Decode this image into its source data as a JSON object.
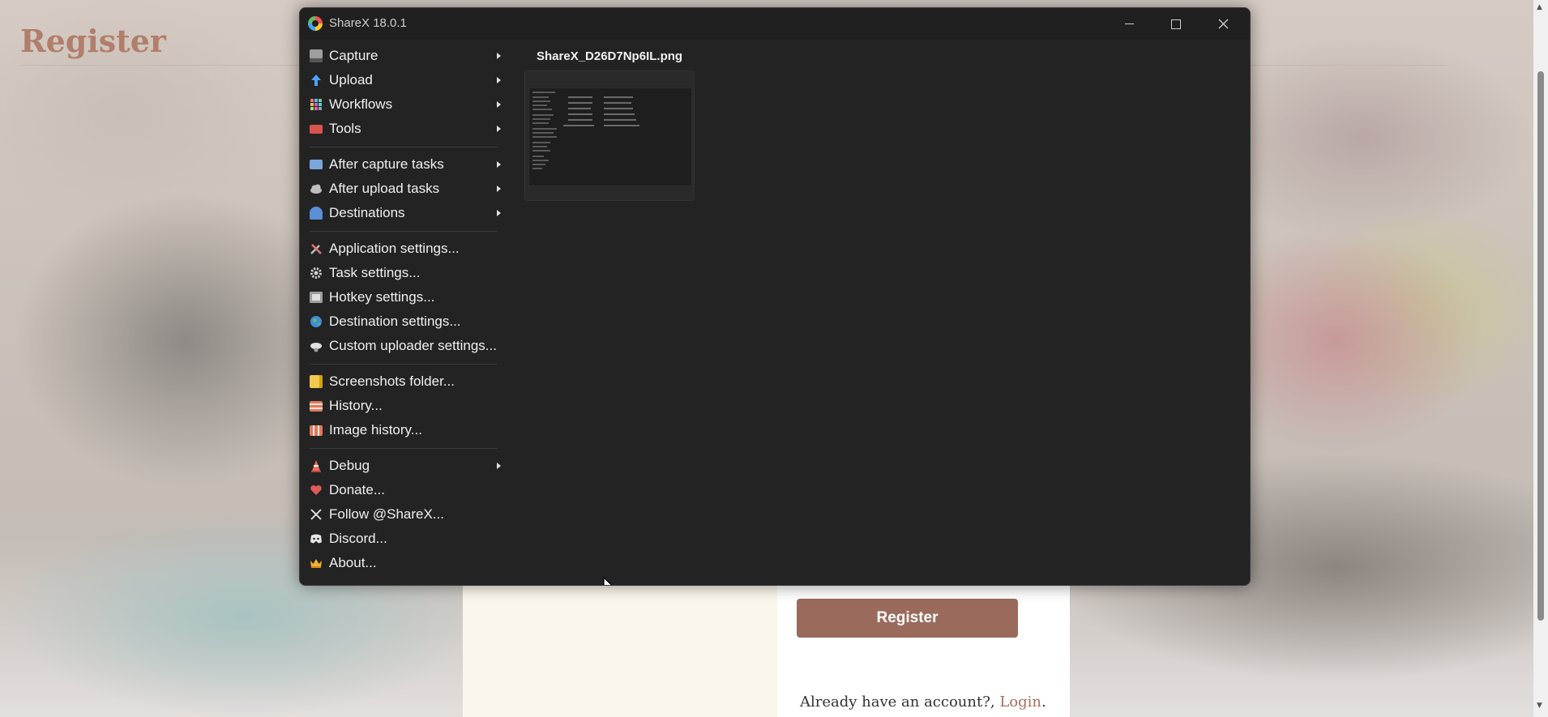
{
  "background_page": {
    "title": "Register",
    "register_button": "Register",
    "login_prompt": "Already have an account?, ",
    "login_link": "Login",
    "login_suffix": "."
  },
  "window": {
    "title": "ShareX 18.0.1",
    "minimize": "minimize",
    "maximize": "maximize",
    "close": "close"
  },
  "menu": {
    "capture": "Capture",
    "upload": "Upload",
    "workflows": "Workflows",
    "tools": "Tools",
    "after_capture_tasks": "After capture tasks",
    "after_upload_tasks": "After upload tasks",
    "destinations": "Destinations",
    "application_settings": "Application settings...",
    "task_settings": "Task settings...",
    "hotkey_settings": "Hotkey settings...",
    "destination_settings": "Destination settings...",
    "custom_uploader_settings": "Custom uploader settings...",
    "screenshots_folder": "Screenshots folder...",
    "history": "History...",
    "image_history": "Image history...",
    "debug": "Debug",
    "donate": "Donate...",
    "follow": "Follow @ShareX...",
    "discord": "Discord...",
    "about": "About..."
  },
  "recent": {
    "filename": "ShareX_D26D7Np6IL.png"
  },
  "colors": {
    "window_bg": "#232323",
    "accent_brown": "#9a6b5c",
    "title_color": "#b07e6a"
  }
}
